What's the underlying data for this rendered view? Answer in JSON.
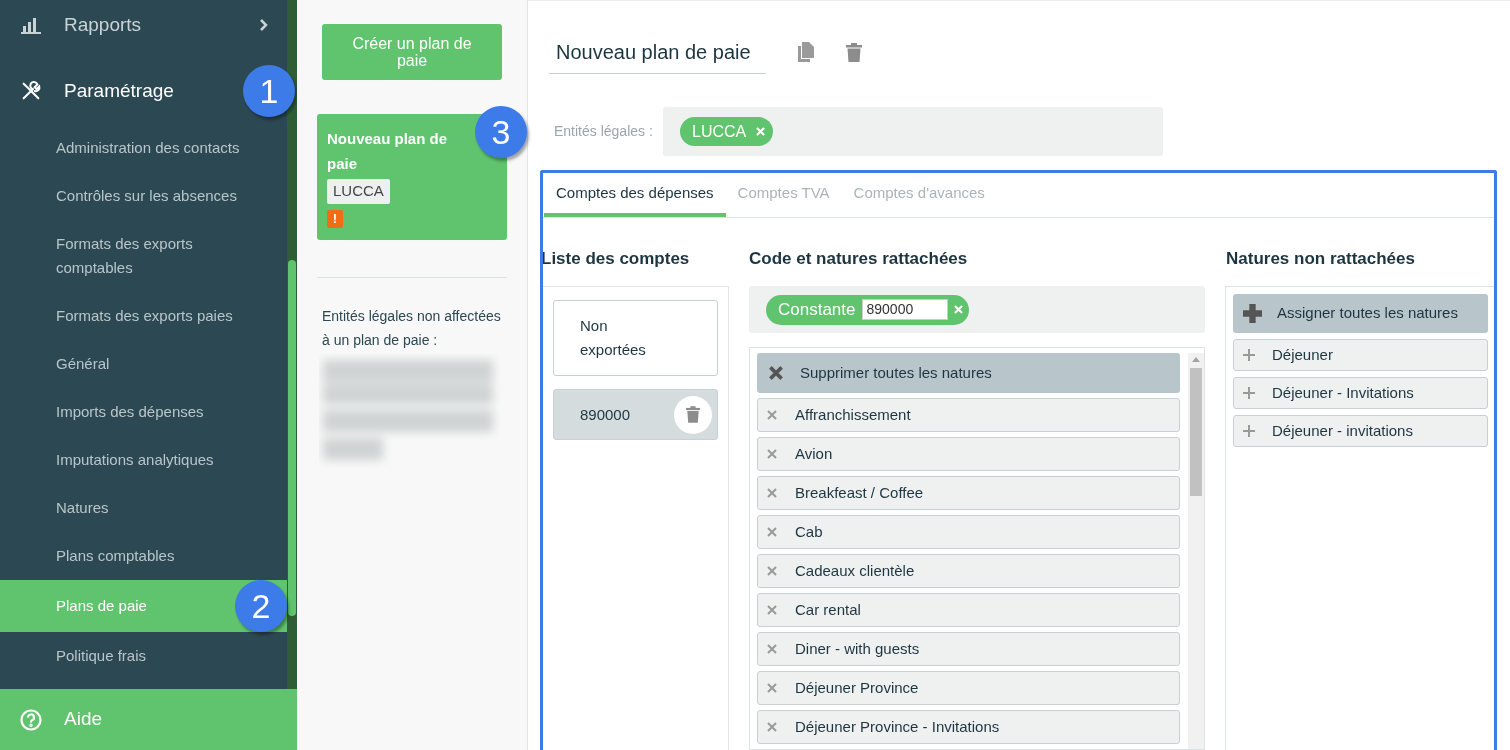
{
  "sidebar": {
    "groups": [
      {
        "label": "Rapports",
        "expanded": false
      },
      {
        "label": "Paramétrage",
        "expanded": true,
        "callout": "1",
        "items": [
          {
            "label": "Administration des contacts",
            "selected": false
          },
          {
            "label": "Contrôles sur les absences",
            "selected": false
          },
          {
            "label": "Formats des exports comptables",
            "selected": false
          },
          {
            "label": "Formats des exports paies",
            "selected": false
          },
          {
            "label": "Général",
            "selected": false
          },
          {
            "label": "Imports des dépenses",
            "selected": false
          },
          {
            "label": "Imputations analytiques",
            "selected": false
          },
          {
            "label": "Natures",
            "selected": false
          },
          {
            "label": "Plans comptables",
            "selected": false
          },
          {
            "label": "Plans de paie",
            "selected": true,
            "callout": "2"
          },
          {
            "label": "Politique frais",
            "selected": false
          }
        ]
      }
    ],
    "help": "Aide"
  },
  "plans_panel": {
    "create_button": "Créer un plan de paie",
    "plans": [
      {
        "title": "Nouveau plan de paie",
        "entity": "LUCCA",
        "warning": "!",
        "selected": true,
        "callout": "3"
      }
    ],
    "unassigned_label": "Entités légales non affectées à un plan de paie :"
  },
  "editor": {
    "plan_name": "Nouveau plan de paie",
    "entities_label": "Entités légales :",
    "entities": [
      "LUCCA"
    ],
    "tabs": [
      {
        "label": "Comptes des dépenses",
        "selected": true
      },
      {
        "label": "Comptes TVA",
        "selected": false
      },
      {
        "label": "Comptes d'avances",
        "selected": false
      }
    ],
    "accounts": {
      "heading": "Liste des comptes",
      "items": [
        {
          "label": "Non exportées",
          "selected": false
        },
        {
          "label": "890000",
          "selected": true
        }
      ]
    },
    "attached": {
      "heading": "Code et natures rattachées",
      "code_kind": "Constante",
      "code_value": "890000",
      "remove_all": "Supprimer toutes les natures",
      "items": [
        "Affranchissement",
        "Avion",
        "Breakfeast / Coffee",
        "Cab",
        "Cadeaux clientèle",
        "Car rental",
        "Diner - with guests",
        "Déjeuner Province",
        "Déjeuner Province - Invitations"
      ]
    },
    "unattached": {
      "heading": "Natures non rattachées",
      "assign_all": "Assigner toutes les natures",
      "items": [
        "Déjeuner",
        "Déjeuner - Invitations",
        "Déjeuner - invitations"
      ]
    }
  }
}
